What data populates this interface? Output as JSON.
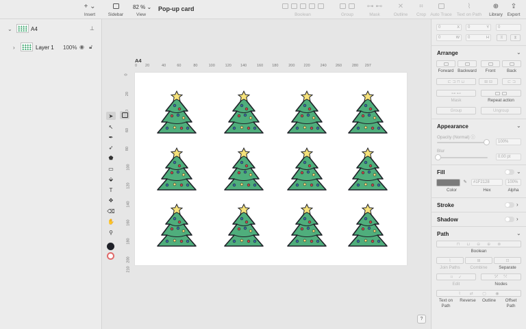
{
  "toolbar": {
    "insert_label": "Insert",
    "sidebar_label": "Sidebar",
    "view_label": "View",
    "zoom_value": "82 %",
    "document_title": "Pop-up card",
    "boolean_label": "Boolean",
    "group_label": "Group",
    "mask_label": "Mask",
    "outline_label": "Outline",
    "crop_label": "Crop",
    "auto_trace_label": "Auto Trace",
    "text_on_path_label": "Text on Path",
    "library_label": "Library",
    "export_label": "Export"
  },
  "layers": {
    "artboard_name": "A4",
    "layer_name": "Layer 1",
    "layer_opacity": "100%"
  },
  "canvas": {
    "artboard_label": "A4",
    "ruler_h": [
      "0",
      "20",
      "40",
      "60",
      "80",
      "100",
      "120",
      "140",
      "160",
      "180",
      "200",
      "220",
      "240",
      "260",
      "280",
      "297"
    ],
    "ruler_v": [
      "0",
      "20",
      "40",
      "60",
      "80",
      "100",
      "120",
      "140",
      "160",
      "180",
      "200",
      "210"
    ],
    "help": "?"
  },
  "inspector": {
    "x_label": "X",
    "y_label": "Y",
    "w_label": "W",
    "h_label": "H",
    "x_value": "0",
    "y_value": "0",
    "w_value": "0",
    "h_value": "0",
    "angle_value": "0",
    "arrange": {
      "title": "Arrange",
      "forward": "Forward",
      "backward": "Backward",
      "front": "Front",
      "back": "Back",
      "mask": "Mask",
      "repeat_action": "Repeat action",
      "group": "Group",
      "ungroup": "Ungroup"
    },
    "appearance": {
      "title": "Appearance",
      "opacity_label": "Opacity (Normal)",
      "opacity_value": "100%",
      "blur_label": "Blur",
      "blur_value": "0.00 pt"
    },
    "fill": {
      "title": "Fill",
      "hex_value": "#1F2128",
      "alpha_value": "100%",
      "color_label": "Color",
      "hex_label": "Hex",
      "alpha_label": "Alpha",
      "color": "#7a7a7a"
    },
    "stroke": {
      "title": "Stroke"
    },
    "shadow": {
      "title": "Shadow"
    },
    "path": {
      "title": "Path",
      "boolean": "Boolean",
      "join_paths": "Join Paths",
      "combine": "Combine",
      "separate": "Separate",
      "edit": "Edit",
      "nodes": "Nodes",
      "text_on_path": "Text on Path",
      "reverse": "Reverse",
      "outline": "Outline",
      "offset_path": "Offset Path"
    }
  },
  "colors": {
    "tree_green": "#4fae7c",
    "tree_outline": "#1f2128",
    "star": "#f6e27a",
    "ornament_blue": "#3a6ea5",
    "ornament_red": "#c94a4a",
    "ornament_yellow": "#f6e27a"
  }
}
